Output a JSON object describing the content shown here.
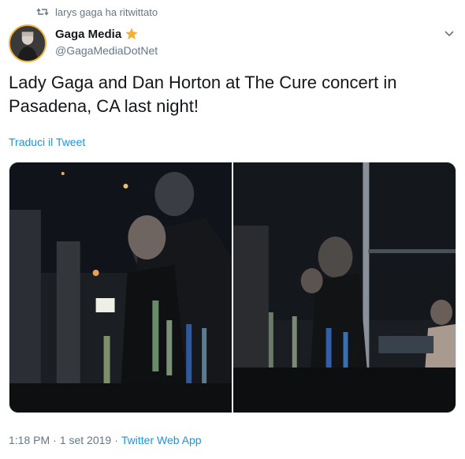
{
  "retweet": {
    "icon": "retweet-icon",
    "text": "larys gaga ha ritwittato"
  },
  "author": {
    "display_name": "Gaga Media",
    "badge_icon": "star-icon",
    "badge_color": "#f5b02d",
    "handle": "@GagaMediaDotNet"
  },
  "tweet": {
    "text": "Lady Gaga and Dan Horton at The Cure concert in Pasadena, CA last night!",
    "translate_label": "Traduci il Tweet"
  },
  "media": {
    "photos": [
      "photo-left",
      "photo-right"
    ]
  },
  "meta": {
    "time": "1:18 PM",
    "separator": "·",
    "date": "1 set 2019",
    "source": "Twitter Web App"
  },
  "colors": {
    "link": "#1b95e0",
    "muted": "#657786",
    "text": "#14171a"
  }
}
